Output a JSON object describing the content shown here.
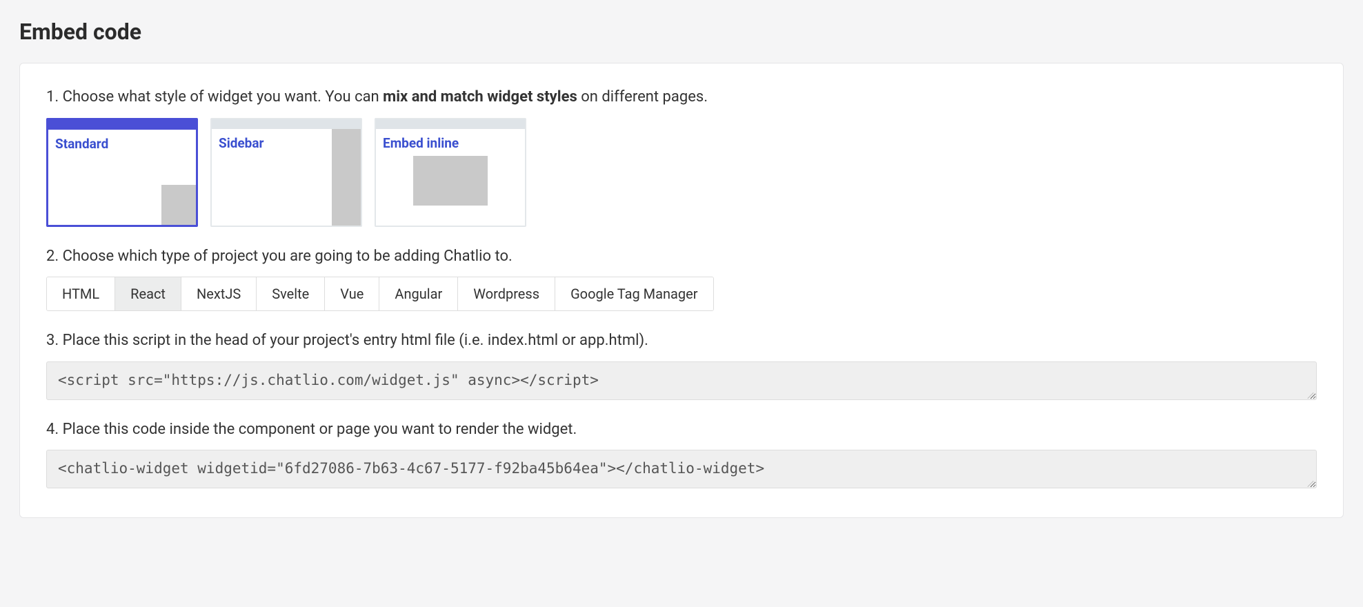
{
  "title": "Embed code",
  "step1": {
    "prefix": "1. Choose what style of widget you want. You can ",
    "bold": "mix and match widget styles",
    "suffix": " on different pages.",
    "tiles": [
      {
        "label": "Standard",
        "selected": true,
        "shape": "corner"
      },
      {
        "label": "Sidebar",
        "selected": false,
        "shape": "side"
      },
      {
        "label": "Embed inline",
        "selected": false,
        "shape": "center"
      }
    ]
  },
  "step2": {
    "text": "2. Choose which type of project you are going to be adding Chatlio to.",
    "tabs": [
      {
        "label": "HTML",
        "active": false
      },
      {
        "label": "React",
        "active": true
      },
      {
        "label": "NextJS",
        "active": false
      },
      {
        "label": "Svelte",
        "active": false
      },
      {
        "label": "Vue",
        "active": false
      },
      {
        "label": "Angular",
        "active": false
      },
      {
        "label": "Wordpress",
        "active": false
      },
      {
        "label": "Google Tag Manager",
        "active": false
      }
    ]
  },
  "step3": {
    "text": "3. Place this script in the head of your project's entry html file (i.e. index.html or app.html).",
    "code": "<script src=\"https://js.chatlio.com/widget.js\" async></script>"
  },
  "step4": {
    "text": "4. Place this code inside the component or page you want to render the widget.",
    "code": "<chatlio-widget widgetid=\"6fd27086-7b63-4c67-5177-f92ba45b64ea\"></chatlio-widget>"
  }
}
